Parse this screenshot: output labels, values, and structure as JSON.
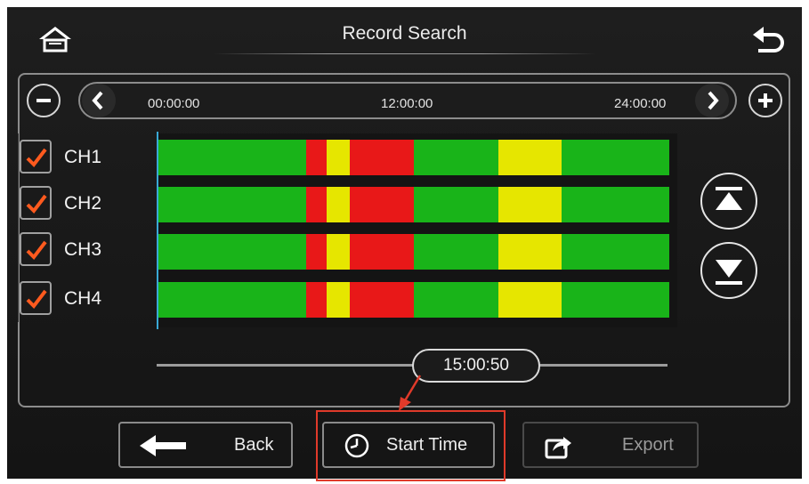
{
  "header": {
    "title": "Record Search",
    "home_icon": "home-icon",
    "back_icon": "return-arrow-icon"
  },
  "timeline": {
    "ticks": [
      "00:00:00",
      "12:00:00",
      "24:00:00"
    ],
    "zoom_out_icon": "minus-icon",
    "zoom_in_icon": "plus-icon",
    "prev_icon": "chevron-left-icon",
    "next_icon": "chevron-right-icon",
    "cursor_color": "#39a9d6"
  },
  "channels": [
    {
      "label": "CH1",
      "checked": true
    },
    {
      "label": "CH2",
      "checked": true
    },
    {
      "label": "CH3",
      "checked": true
    },
    {
      "label": "CH4",
      "checked": true
    }
  ],
  "record_types": {
    "colors": {
      "normal": "#19b419",
      "alarm": "#e81818",
      "event": "#e6e600"
    },
    "segments_fraction": [
      {
        "type": "normal",
        "start": 0.0,
        "end": 0.29
      },
      {
        "type": "alarm",
        "start": 0.29,
        "end": 0.33
      },
      {
        "type": "event",
        "start": 0.33,
        "end": 0.375
      },
      {
        "type": "alarm",
        "start": 0.375,
        "end": 0.5
      },
      {
        "type": "normal",
        "start": 0.5,
        "end": 0.665
      },
      {
        "type": "event",
        "start": 0.665,
        "end": 0.79
      },
      {
        "type": "normal",
        "start": 0.79,
        "end": 1.0
      }
    ]
  },
  "scroll": {
    "top_icon": "scroll-to-top-icon",
    "bottom_icon": "scroll-to-bottom-icon"
  },
  "slider": {
    "value": "15:00:50"
  },
  "buttons": {
    "back": {
      "label": "Back",
      "icon": "left-arrow-icon"
    },
    "start_time": {
      "label": "Start Time",
      "icon": "clock-icon"
    },
    "export": {
      "label": "Export",
      "icon": "share-export-icon"
    }
  },
  "annotation_color": "#e03a2a"
}
